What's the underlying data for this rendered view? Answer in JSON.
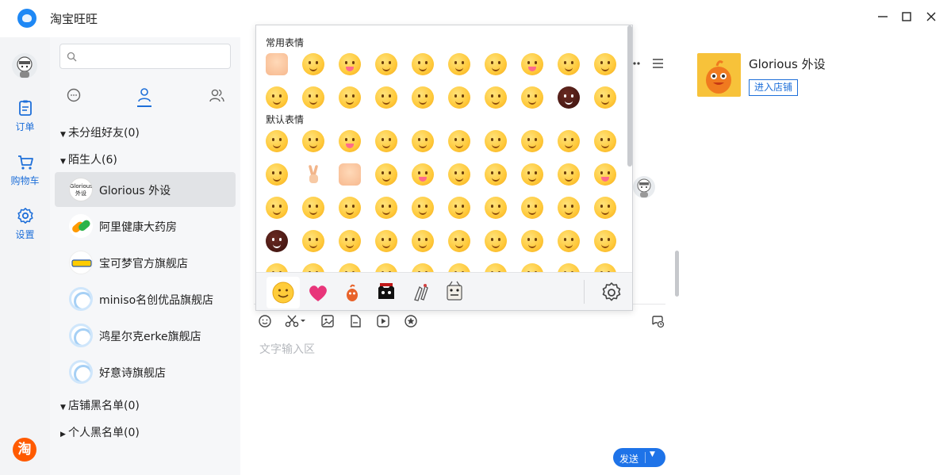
{
  "window": {
    "title": "淘宝旺旺",
    "minimize": "—",
    "maximize": "☐",
    "close": "✕"
  },
  "leftnav": {
    "items": [
      {
        "label": "订单",
        "icon": "order-icon"
      },
      {
        "label": "购物车",
        "icon": "cart-icon"
      },
      {
        "label": "设置",
        "icon": "settings-icon"
      }
    ],
    "taobao_label": "淘"
  },
  "contacts": {
    "search_placeholder": "",
    "tabs": [
      {
        "icon": "chat-bubble-icon"
      },
      {
        "icon": "contact-person-icon",
        "active": true
      },
      {
        "icon": "group-icon"
      }
    ],
    "groups": [
      {
        "label": "未分组好友(0)",
        "expanded": true
      },
      {
        "label": "陌生人(6)",
        "expanded": true
      },
      {
        "label": "店铺黑名单(0)",
        "expanded": true
      },
      {
        "label": "个人黑名单(0)",
        "expanded": false
      }
    ],
    "items": [
      {
        "name": "Glorious 外设",
        "avatar_text": "Glorious 外设",
        "selected": true
      },
      {
        "name": "阿里健康大药房"
      },
      {
        "name": "宝可梦官方旗舰店"
      },
      {
        "name": "miniso名创优品旗舰店"
      },
      {
        "name": "鸿星尔克erke旗舰店"
      },
      {
        "name": "好意诗旗舰店"
      }
    ]
  },
  "chat": {
    "input_placeholder": "文字输入区",
    "send_label": "发送",
    "toolbar": [
      {
        "icon": "emoji-icon"
      },
      {
        "icon": "scissors-icon"
      },
      {
        "icon": "image-icon"
      },
      {
        "icon": "file-icon"
      },
      {
        "icon": "video-icon"
      },
      {
        "icon": "star-icon"
      },
      {
        "icon": "chat-history-icon"
      }
    ]
  },
  "shop": {
    "name": "Glorious 外设",
    "enter_label": "进入店铺"
  },
  "emoji_panel": {
    "frequent_title": "常用表情",
    "default_title": "默认表情",
    "tabs": [
      {
        "icon": "smiley-tab-icon",
        "active": true
      },
      {
        "icon": "heart-tab-icon"
      },
      {
        "icon": "mascot-tab-icon"
      },
      {
        "icon": "cat-tab-icon"
      },
      {
        "icon": "sticker-tab-icon"
      },
      {
        "icon": "sticker2-tab-icon"
      },
      {
        "icon": "gear-icon"
      }
    ]
  },
  "colors": {
    "accent": "#1e73e8",
    "nav_bg": "#f3f4f6",
    "taobao_orange": "#ff5a00"
  }
}
